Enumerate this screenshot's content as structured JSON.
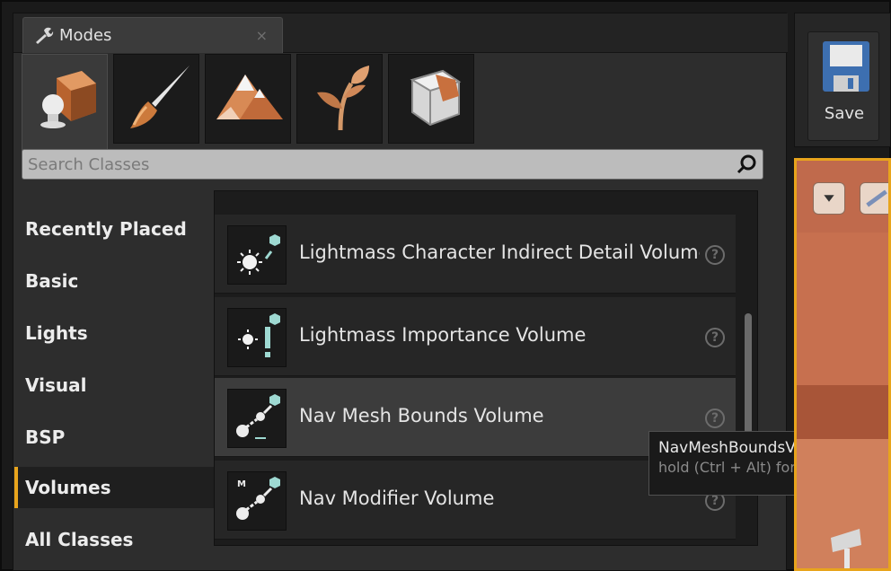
{
  "modes_tab": {
    "label": "Modes",
    "close_glyph": "×"
  },
  "mode_buttons": [
    {
      "name": "place-mode",
      "icon": "place-mode-icon",
      "active": true
    },
    {
      "name": "paint-mode",
      "icon": "paintbrush-icon",
      "active": false
    },
    {
      "name": "landscape-mode",
      "icon": "mountains-icon",
      "active": false
    },
    {
      "name": "foliage-mode",
      "icon": "foliage-icon",
      "active": false
    },
    {
      "name": "geometry-mode",
      "icon": "geometry-cube-icon",
      "active": false
    }
  ],
  "search": {
    "placeholder": "Search Classes",
    "value": ""
  },
  "categories": [
    {
      "label": "Recently Placed",
      "selected": false
    },
    {
      "label": "Basic",
      "selected": false
    },
    {
      "label": "Lights",
      "selected": false
    },
    {
      "label": "Visual",
      "selected": false
    },
    {
      "label": "BSP",
      "selected": false
    },
    {
      "label": "Volumes",
      "selected": true
    },
    {
      "label": "All Classes",
      "selected": false
    }
  ],
  "classes": [
    {
      "label": "Lightmass Character Indirect Detail Volume",
      "icon": "lightmass-detail-icon",
      "help": "?"
    },
    {
      "label": "Lightmass Importance Volume",
      "icon": "lightmass-importance-icon",
      "help": "?"
    },
    {
      "label": "Nav Mesh Bounds Volume",
      "icon": "nav-mesh-icon",
      "help": "?"
    },
    {
      "label": "Nav Modifier Volume",
      "icon": "nav-modifier-icon",
      "help": "?"
    }
  ],
  "tooltip": {
    "title": "NavMeshBoundsVolume",
    "subtitle": "hold (Ctrl + Alt) for more"
  },
  "toolbar": {
    "save_label": "Save"
  },
  "colors": {
    "accent": "#e8a41c",
    "panel": "#2d2d2d",
    "viewport": "#c06a4c"
  }
}
